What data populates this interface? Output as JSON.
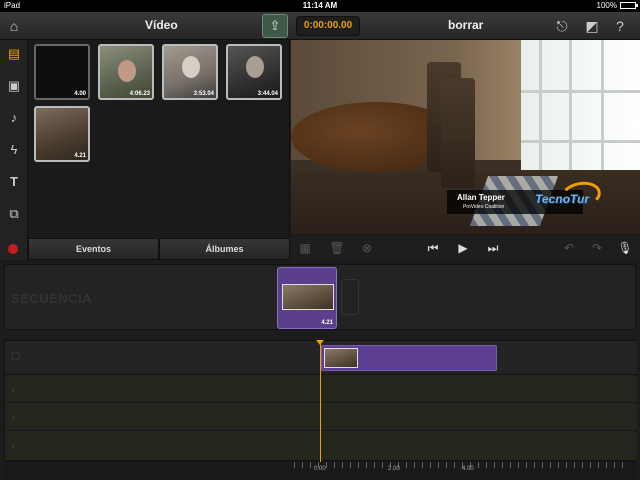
{
  "status": {
    "carrier": "iPad",
    "time": "11:14 AM",
    "battery": "100%"
  },
  "topbar": {
    "section_title": "Vídeo",
    "timecode": "0:00:00.00",
    "project_title": "borrar"
  },
  "library": {
    "clips": [
      {
        "duration": "4.00"
      },
      {
        "duration": "4:06.23"
      },
      {
        "duration": "3:53.04"
      },
      {
        "duration": "3:44.04"
      },
      {
        "duration": "4.21"
      }
    ],
    "tabs": [
      "Eventos",
      "Álbumes"
    ]
  },
  "viewer": {
    "lower_third_name": "Allan Tepper",
    "lower_third_sub": "ProVideo Coalition",
    "logo_text": "TecnoTur"
  },
  "sequence": {
    "label": "SECUENCIA",
    "clip_duration": "4.21"
  },
  "ruler": {
    "labels": [
      "0.00",
      "2.00",
      "4.00"
    ]
  },
  "icons": {
    "home": "home-icon",
    "share": "share-icon",
    "export": "export-icon",
    "settings": "settings-icon",
    "help": "help-icon",
    "video": "film-icon",
    "photo": "photo-icon",
    "music": "music-icon",
    "effects": "lightning-icon",
    "titles": "text-icon",
    "transitions": "layers-icon"
  },
  "colors": {
    "accent": "#f0a000",
    "clip": "#5b3f8c",
    "record": "#c41e1e"
  }
}
